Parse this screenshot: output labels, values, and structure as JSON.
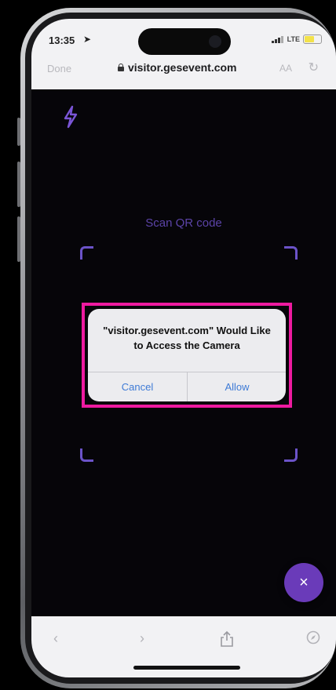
{
  "status_bar": {
    "time": "13:35",
    "network": "LTE"
  },
  "browser": {
    "done_label": "Done",
    "url": "visitor.gesevent.com",
    "text_size_label": "AA"
  },
  "page": {
    "scan_title": "Scan QR code"
  },
  "dialog": {
    "message": "\"visitor.gesevent.com\" Would Like to Access the Camera",
    "cancel_label": "Cancel",
    "allow_label": "Allow"
  },
  "fab": {
    "close_symbol": "×"
  },
  "icons": {
    "flash": "lightning-icon",
    "back": "chevron-left-icon",
    "forward": "chevron-right-icon",
    "share": "share-icon",
    "compass": "compass-icon",
    "reload": "reload-icon"
  },
  "colors": {
    "accent": "#6a3bb9",
    "scan_frame": "#6b53c8",
    "highlight": "#ee1aa0",
    "dialog_button": "#3f7bd6"
  }
}
